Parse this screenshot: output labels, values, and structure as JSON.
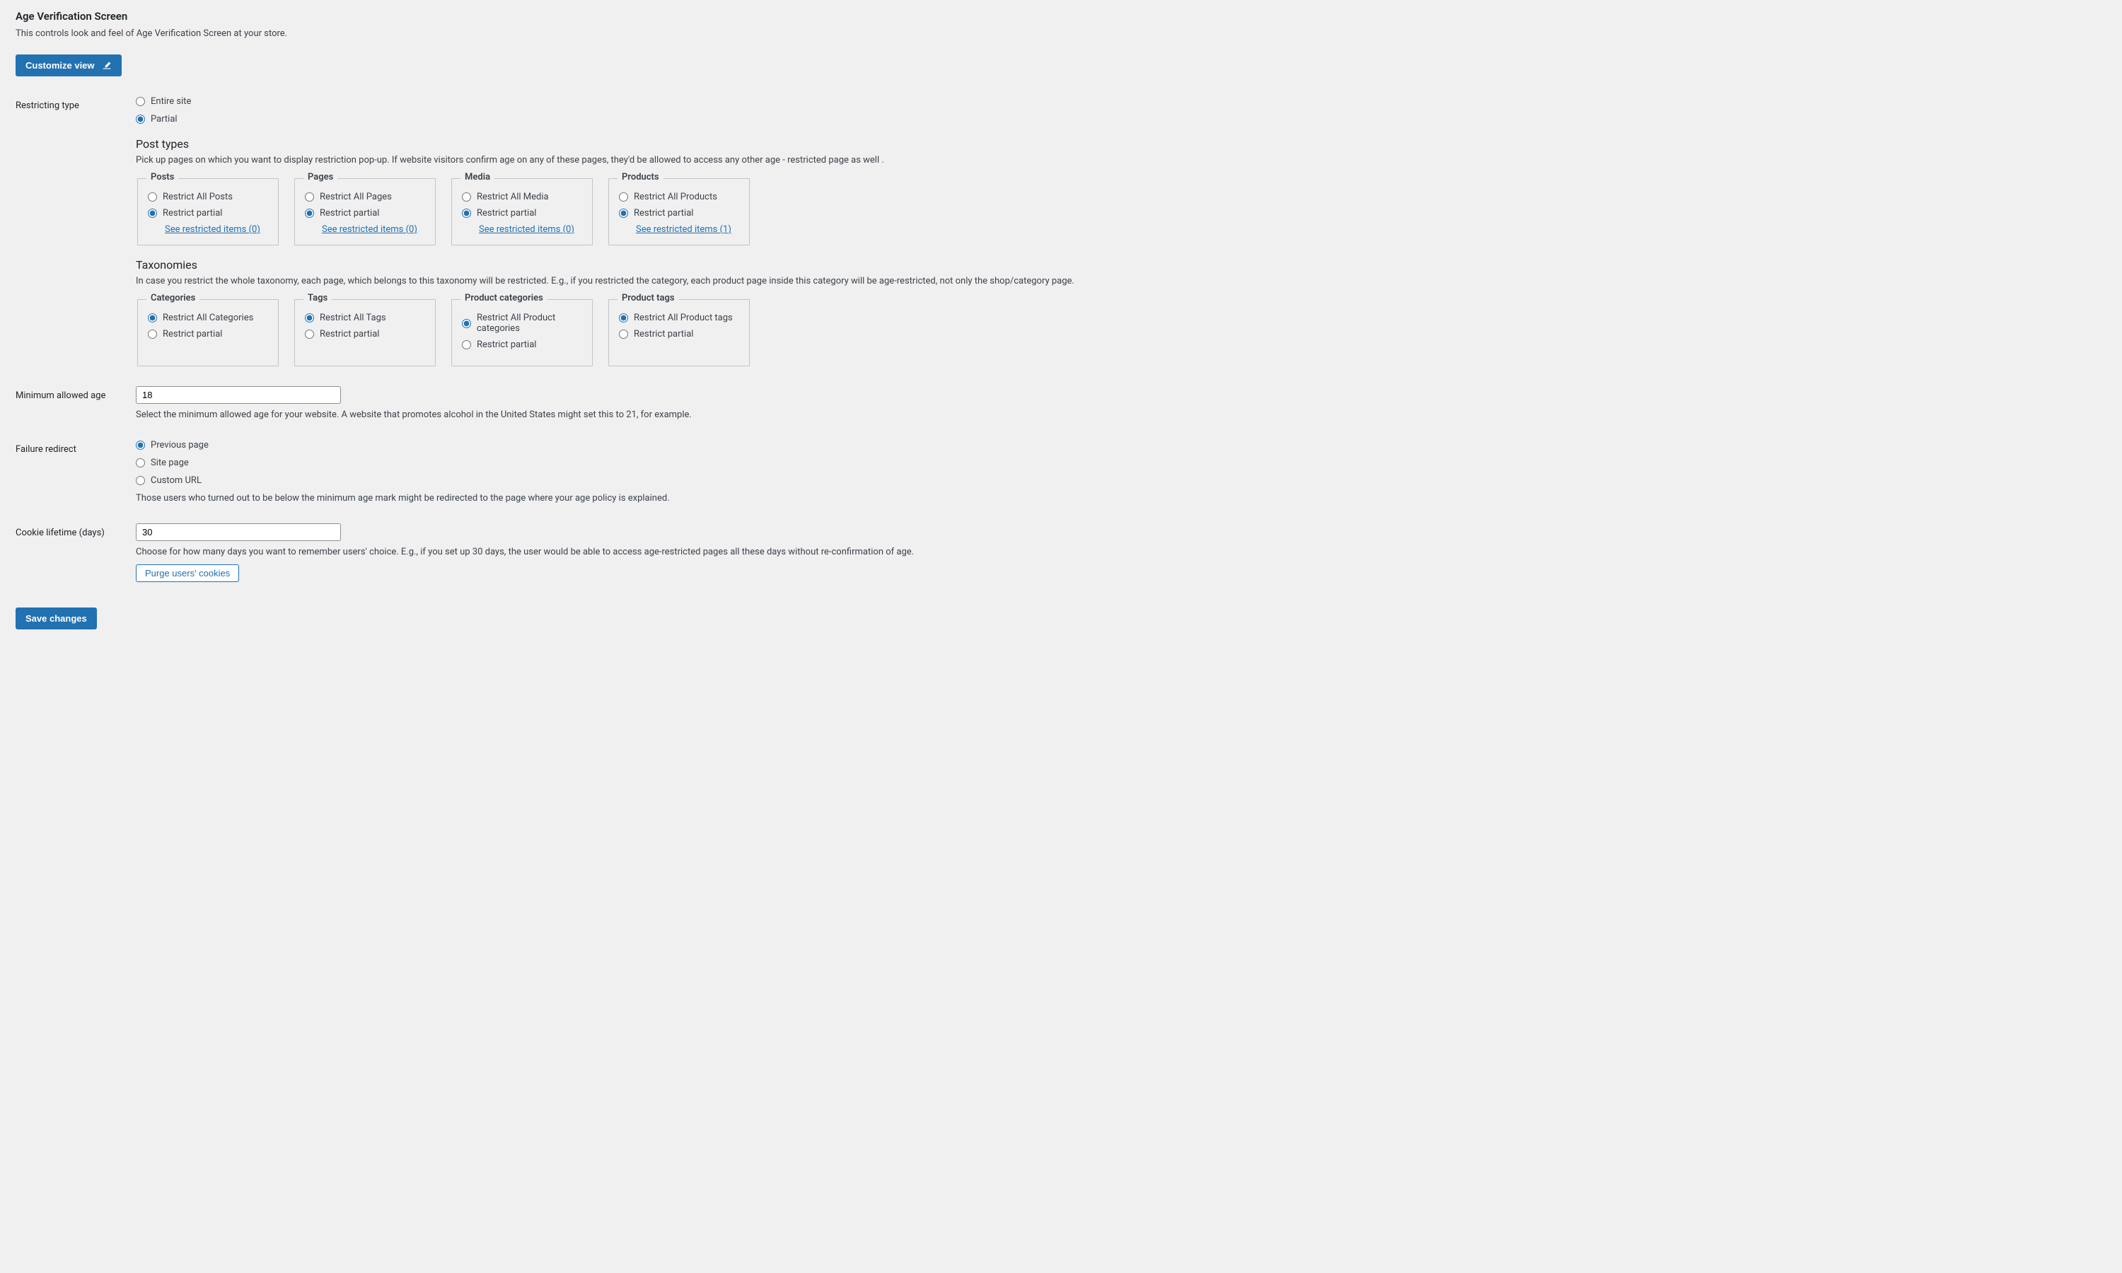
{
  "header": {
    "title": "Age Verification Screen",
    "description": "This controls look and feel of Age Verification Screen at your store.",
    "customize_button": "Customize view"
  },
  "restricting_type": {
    "label": "Restricting type",
    "options": {
      "entire": "Entire site",
      "partial": "Partial"
    },
    "selected": "partial"
  },
  "post_types": {
    "heading": "Post types",
    "description": "Pick up pages on which you want to display restriction pop-up. If website visitors confirm age on any of these pages, they'd be allowed to access any other age - restricted page as well .",
    "groups": [
      {
        "legend": "Posts",
        "all_label": "Restrict All Posts",
        "partial_label": "Restrict partial",
        "selected": "partial",
        "link": "See restricted items (0)"
      },
      {
        "legend": "Pages",
        "all_label": "Restrict All Pages",
        "partial_label": "Restrict partial",
        "selected": "partial",
        "link": "See restricted items (0)"
      },
      {
        "legend": "Media",
        "all_label": "Restrict All Media",
        "partial_label": "Restrict partial",
        "selected": "partial",
        "link": "See restricted items (0)"
      },
      {
        "legend": "Products",
        "all_label": "Restrict All Products",
        "partial_label": "Restrict partial",
        "selected": "partial",
        "link": "See restricted items (1)"
      }
    ]
  },
  "taxonomies": {
    "heading": "Taxonomies",
    "description": "In case you restrict the whole taxonomy, each page, which belongs to this taxonomy will be restricted. E.g., if you restricted the category, each product page inside this category will be age-restricted, not only the shop/category page.",
    "groups": [
      {
        "legend": "Categories",
        "all_label": "Restrict All Categories",
        "partial_label": "Restrict partial",
        "selected": "all"
      },
      {
        "legend": "Tags",
        "all_label": "Restrict All Tags",
        "partial_label": "Restrict partial",
        "selected": "all"
      },
      {
        "legend": "Product categories",
        "all_label": "Restrict All Product categories",
        "partial_label": "Restrict partial",
        "selected": "all"
      },
      {
        "legend": "Product tags",
        "all_label": "Restrict All Product tags",
        "partial_label": "Restrict partial",
        "selected": "all"
      }
    ]
  },
  "min_age": {
    "label": "Minimum allowed age",
    "value": "18",
    "help": "Select the minimum allowed age for your website. A website that promotes alcohol in the United States might set this to 21, for example."
  },
  "failure_redirect": {
    "label": "Failure redirect",
    "options": {
      "previous": "Previous page",
      "site": "Site page",
      "custom": "Custom URL"
    },
    "selected": "previous",
    "help": "Those users who turned out to be below the minimum age mark might be redirected to the page where your age policy is explained."
  },
  "cookie_lifetime": {
    "label": "Cookie lifetime (days)",
    "value": "30",
    "help": "Choose for how many days you want to remember users' choice. E.g., if you set up 30 days, the user would be able to access age-restricted pages all these days without re-confirmation of age.",
    "purge_button": "Purge users' cookies"
  },
  "save_button": "Save changes"
}
